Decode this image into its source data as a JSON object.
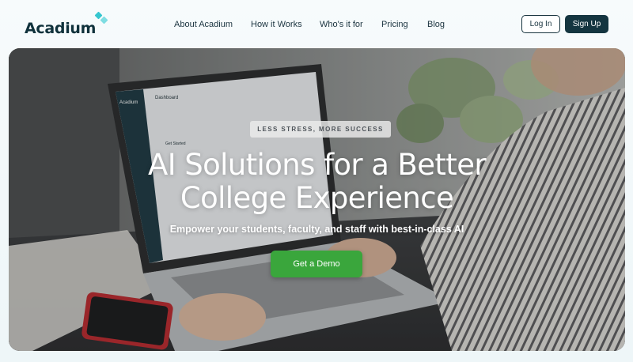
{
  "brand": {
    "name": "Acadium",
    "accent": "#36c6cf"
  },
  "nav": {
    "items": [
      {
        "label": "About Acadium"
      },
      {
        "label": "How it Works"
      },
      {
        "label": "Who's it for"
      },
      {
        "label": "Pricing"
      },
      {
        "label": "Blog"
      }
    ],
    "login_label": "Log In",
    "signup_label": "Sign Up"
  },
  "hero": {
    "eyebrow": "LESS STRESS, MORE SUCCESS",
    "headline_line1": "AI Solutions for a Better",
    "headline_line2": "College Experience",
    "subheadline": "Empower your students, faculty, and staff with best-in-class AI",
    "cta_label": "Get a Demo",
    "cta_color": "#3aa63c"
  },
  "laptop_screen": {
    "brand": "Acadium",
    "title": "Dashboard",
    "section": "Get Started"
  }
}
